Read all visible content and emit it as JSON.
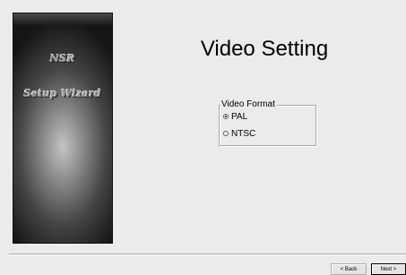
{
  "side_panel": {
    "brand_name": "NSR",
    "brand_subtitle": "Setup Wizard"
  },
  "page": {
    "title": "Video Setting"
  },
  "video_format": {
    "legend": "Video Format",
    "options": [
      {
        "label": "PAL",
        "selected": true
      },
      {
        "label": "NTSC",
        "selected": false
      }
    ]
  },
  "navigation": {
    "back_label": "< Back",
    "next_label": "Next >"
  }
}
